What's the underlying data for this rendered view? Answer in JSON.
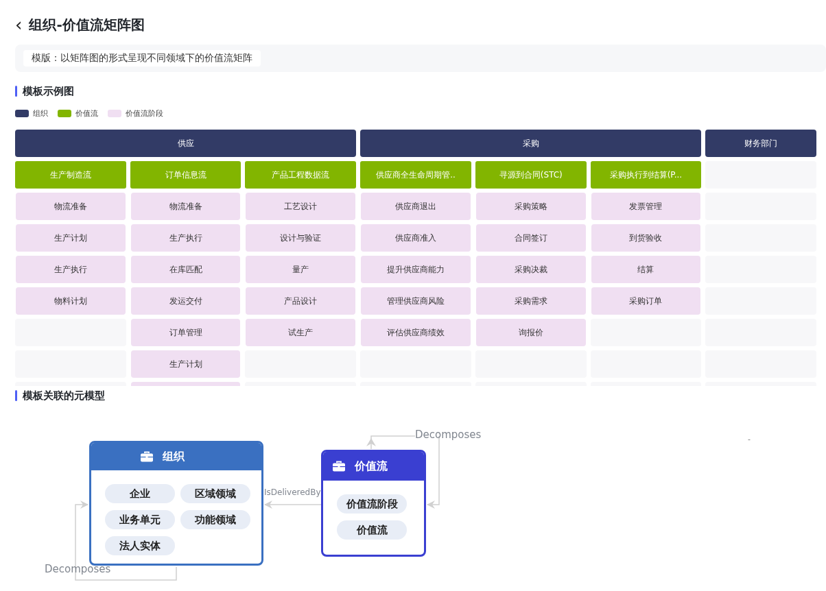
{
  "header": {
    "back_icon": "‹",
    "title": "组织-价值流矩阵图"
  },
  "description": "模版：以矩阵图的形式呈现不同领域下的价值流矩阵",
  "sections": [
    {
      "title": "模板示例图"
    },
    {
      "title": "模板关联的元模型"
    }
  ],
  "legend": [
    {
      "label": "组织",
      "color": "#323b66"
    },
    {
      "label": "价值流",
      "color": "#82b500"
    },
    {
      "label": "价值流阶段",
      "color": "#f0dff2"
    }
  ],
  "matrix": {
    "organizations": [
      {
        "name": "供应",
        "value_streams": [
          {
            "name": "生产制造流",
            "stages": [
              "物流准备",
              "生产计划",
              "生产执行",
              "物料计划"
            ],
            "more_below": false
          },
          {
            "name": "订单信息流",
            "stages": [
              "物流准备",
              "生产执行",
              "在库匹配",
              "发运交付",
              "订单管理",
              "生产计划"
            ],
            "more_below": true
          },
          {
            "name": "产品工程数据流",
            "stages": [
              "工艺设计",
              "设计与验证",
              "量产",
              "产品设计",
              "试生产"
            ],
            "more_below": false
          }
        ]
      },
      {
        "name": "采购",
        "value_streams": [
          {
            "name": "供应商全生命周期管..",
            "stages": [
              "供应商退出",
              "供应商准入",
              "提升供应商能力",
              "管理供应商风险",
              "评估供应商绩效"
            ],
            "more_below": false
          },
          {
            "name": "寻源到合同(STC)",
            "stages": [
              "采购策略",
              "合同签订",
              "采购决裁",
              "采购需求",
              "询报价"
            ],
            "more_below": false
          },
          {
            "name": "采购执行到结算(P...",
            "stages": [
              "发票管理",
              "到货验收",
              "结算",
              "采购订单"
            ],
            "more_below": false
          }
        ]
      },
      {
        "name": "财务部门"
      }
    ]
  },
  "metamodel": {
    "nodes": [
      {
        "title": "组织",
        "kind": "organization",
        "items": [
          "企业",
          "区域领域",
          "业务单元",
          "功能领域",
          "法人实体"
        ]
      },
      {
        "title": "价值流",
        "kind": "value_stream",
        "items": [
          "价值流阶段",
          "价值流"
        ]
      }
    ],
    "edges": [
      {
        "label": "IsDeliveredBy",
        "kind": "between"
      },
      {
        "label": "Decomposes",
        "kind": "self_org"
      },
      {
        "label": "Decomposes",
        "kind": "self_vs"
      }
    ],
    "stray_mark": "-"
  }
}
